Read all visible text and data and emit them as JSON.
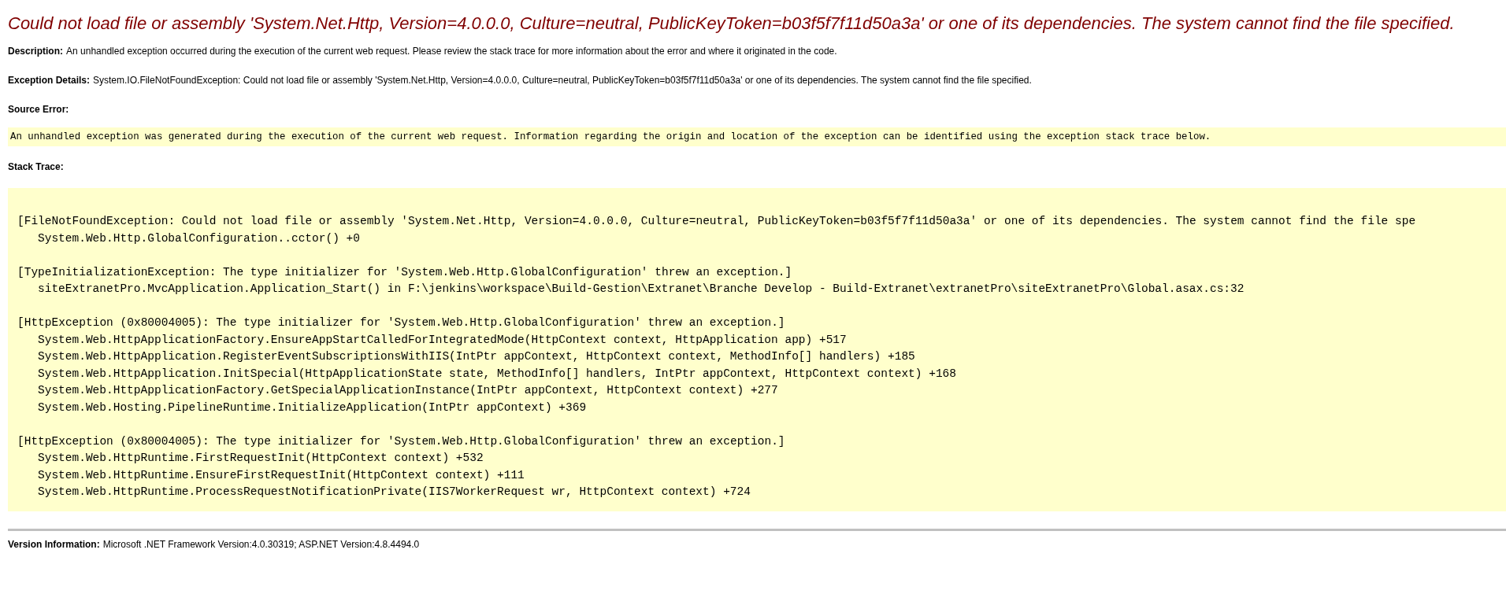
{
  "title": "Could not load file or assembly 'System.Net.Http, Version=4.0.0.0, Culture=neutral, PublicKeyToken=b03f5f7f11d50a3a' or one of its dependencies. The system cannot find the file specified.",
  "description": {
    "label": "Description:",
    "text": "An unhandled exception occurred during the execution of the current web request. Please review the stack trace for more information about the error and where it originated in the code."
  },
  "exception_details": {
    "label": "Exception Details:",
    "text": "System.IO.FileNotFoundException: Could not load file or assembly 'System.Net.Http, Version=4.0.0.0, Culture=neutral, PublicKeyToken=b03f5f7f11d50a3a' or one of its dependencies. The system cannot find the file specified."
  },
  "source_error": {
    "label": "Source Error:",
    "text": "An unhandled exception was generated during the execution of the current web request. Information regarding the origin and location of the exception can be identified using the exception stack trace below."
  },
  "stack_trace": {
    "label": "Stack Trace:",
    "blocks": [
      {
        "header": "[FileNotFoundException: Could not load file or assembly 'System.Net.Http, Version=4.0.0.0, Culture=neutral, PublicKeyToken=b03f5f7f11d50a3a' or one of its dependencies. The system cannot find the file spe",
        "frames": [
          "System.Web.Http.GlobalConfiguration..cctor() +0"
        ]
      },
      {
        "header": "[TypeInitializationException: The type initializer for 'System.Web.Http.GlobalConfiguration' threw an exception.]",
        "frames": [
          "siteExtranetPro.MvcApplication.Application_Start() in F:\\jenkins\\workspace\\Build-Gestion\\Extranet\\Branche Develop - Build-Extranet\\extranetPro\\siteExtranetPro\\Global.asax.cs:32"
        ]
      },
      {
        "header": "[HttpException (0x80004005): The type initializer for 'System.Web.Http.GlobalConfiguration' threw an exception.]",
        "frames": [
          "System.Web.HttpApplicationFactory.EnsureAppStartCalledForIntegratedMode(HttpContext context, HttpApplication app) +517",
          "System.Web.HttpApplication.RegisterEventSubscriptionsWithIIS(IntPtr appContext, HttpContext context, MethodInfo[] handlers) +185",
          "System.Web.HttpApplication.InitSpecial(HttpApplicationState state, MethodInfo[] handlers, IntPtr appContext, HttpContext context) +168",
          "System.Web.HttpApplicationFactory.GetSpecialApplicationInstance(IntPtr appContext, HttpContext context) +277",
          "System.Web.Hosting.PipelineRuntime.InitializeApplication(IntPtr appContext) +369"
        ]
      },
      {
        "header": "[HttpException (0x80004005): The type initializer for 'System.Web.Http.GlobalConfiguration' threw an exception.]",
        "frames": [
          "System.Web.HttpRuntime.FirstRequestInit(HttpContext context) +532",
          "System.Web.HttpRuntime.EnsureFirstRequestInit(HttpContext context) +111",
          "System.Web.HttpRuntime.ProcessRequestNotificationPrivate(IIS7WorkerRequest wr, HttpContext context) +724"
        ]
      }
    ]
  },
  "version_information": {
    "label": "Version Information:",
    "text": "Microsoft .NET Framework Version:4.0.30319; ASP.NET Version:4.8.4494.0"
  }
}
